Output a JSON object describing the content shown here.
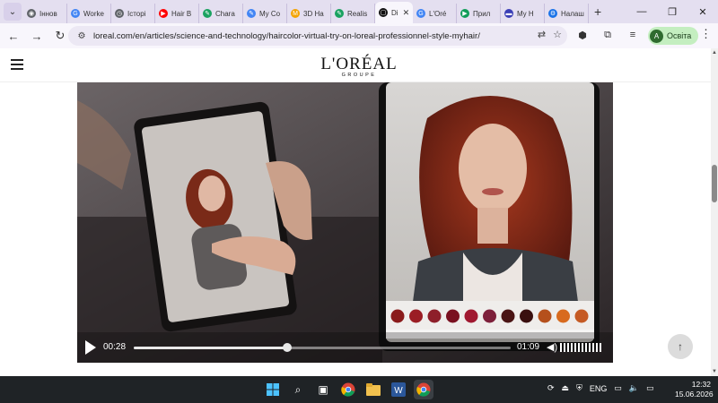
{
  "browser": {
    "tabs": [
      {
        "label": "Іннов",
        "fav_color": "#5f6368",
        "fav_glyph": "◉"
      },
      {
        "label": "Worke",
        "fav_color": "#4285f4",
        "fav_glyph": "G"
      },
      {
        "label": "Історі",
        "fav_color": "#5f6368",
        "fav_glyph": "◷"
      },
      {
        "label": "Hair B",
        "fav_color": "#ff0000",
        "fav_glyph": "▶"
      },
      {
        "label": "Chara",
        "fav_color": "#1aa260",
        "fav_glyph": "✎"
      },
      {
        "label": "My Co",
        "fav_color": "#4285f4",
        "fav_glyph": "✎"
      },
      {
        "label": "3D Ha",
        "fav_color": "#f4a300",
        "fav_glyph": "M"
      },
      {
        "label": "Realis",
        "fav_color": "#1aa260",
        "fav_glyph": "✎"
      },
      {
        "label": "Di",
        "fav_color": "#111111",
        "fav_glyph": "▢",
        "active": true
      },
      {
        "label": "L'Oré",
        "fav_color": "#4285f4",
        "fav_glyph": "G"
      },
      {
        "label": "Прил",
        "fav_color": "#0f9d58",
        "fav_glyph": "▶"
      },
      {
        "label": "My H",
        "fav_color": "#3b3fb6",
        "fav_glyph": "▬"
      },
      {
        "label": "Налаш",
        "fav_color": "#1a73e8",
        "fav_glyph": "⚙"
      }
    ],
    "url": "loreal.com/en/articles/science-and-technology/haircolor-virtual-try-on-loreal-professionnel-style-myhair/",
    "profile_initial": "A",
    "profile_label": "Освіта"
  },
  "site": {
    "logo_main": "L'ORÉAL",
    "logo_sub": "GROUPE"
  },
  "video": {
    "current_time": "00:28",
    "duration": "01:09",
    "progress_fraction": 0.406,
    "volume_fraction": 1.0,
    "swatch_colors": [
      "#8a1a1a",
      "#9b1d24",
      "#8e1f2a",
      "#7a1020",
      "#a01830",
      "#7d1f3a",
      "#4a1414",
      "#3a0f0f",
      "#b5501c",
      "#d86a1e",
      "#c55a24"
    ]
  },
  "taskbar": {
    "language": "ENG",
    "time": "12:32",
    "date": "15.06.2026"
  },
  "colors": {
    "tab_strip": "#e4dff0",
    "toolbar": "#f8f6fc",
    "profile_bg": "#c4eec0",
    "taskbar": "#1f2326"
  }
}
